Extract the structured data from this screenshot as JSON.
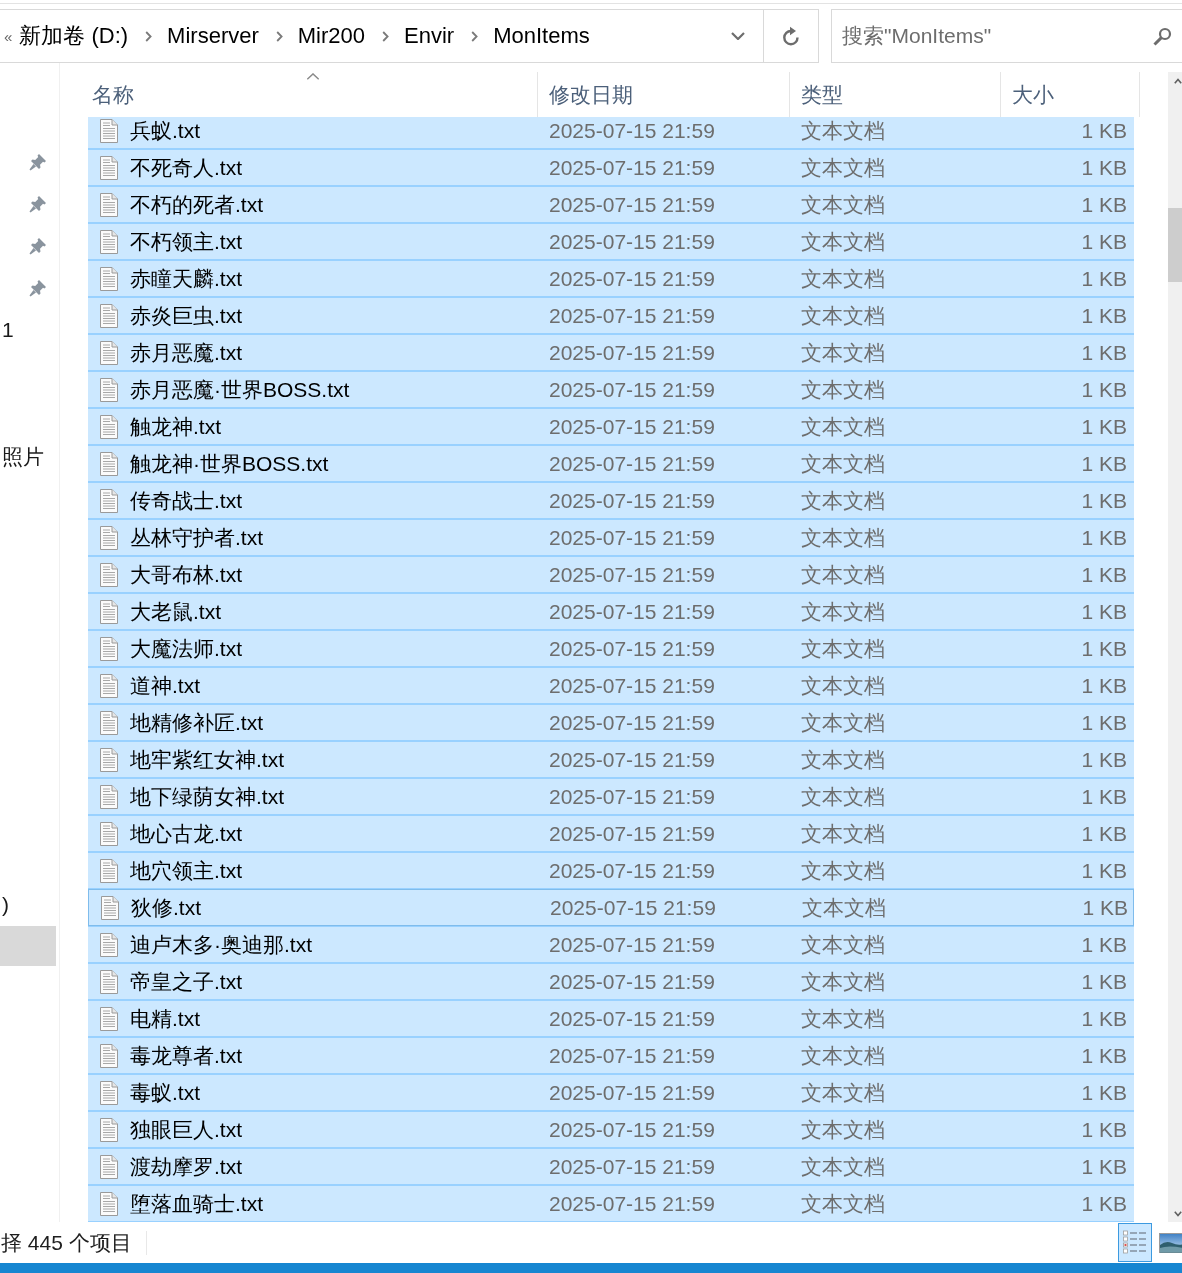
{
  "address_bar": {
    "overflow": "«",
    "crumbs": [
      "新加卷 (D:)",
      "Mirserver",
      "Mir200",
      "Envir",
      "MonItems"
    ]
  },
  "search": {
    "placeholder": "搜索\"MonItems\""
  },
  "nav_pane": {
    "items": [
      {
        "pinned": true,
        "selected": false
      },
      {
        "pinned": true,
        "selected": false
      },
      {
        "pinned": true,
        "selected": false
      },
      {
        "pinned": true,
        "selected": false
      },
      {
        "label": "1",
        "pinned": false,
        "selected": false
      },
      {
        "label": "照片",
        "pinned": false,
        "selected": false
      },
      {
        "label": ")",
        "pinned": false,
        "selected": false
      },
      {
        "pinned": false,
        "selected": true
      }
    ]
  },
  "file_list": {
    "columns": [
      {
        "label": "名称",
        "sorted": true
      },
      {
        "label": "修改日期",
        "sorted": false
      },
      {
        "label": "类型",
        "sorted": false
      },
      {
        "label": "大小",
        "sorted": false
      }
    ],
    "rows": [
      {
        "name": "兵蚁.txt",
        "modified": "2025-07-15 21:59",
        "type": "文本文档",
        "size": "1 KB",
        "selected": true,
        "focused": false
      },
      {
        "name": "不死奇人.txt",
        "modified": "2025-07-15 21:59",
        "type": "文本文档",
        "size": "1 KB",
        "selected": true,
        "focused": false
      },
      {
        "name": "不朽的死者.txt",
        "modified": "2025-07-15 21:59",
        "type": "文本文档",
        "size": "1 KB",
        "selected": true,
        "focused": false
      },
      {
        "name": "不朽领主.txt",
        "modified": "2025-07-15 21:59",
        "type": "文本文档",
        "size": "1 KB",
        "selected": true,
        "focused": false
      },
      {
        "name": "赤瞳天麟.txt",
        "modified": "2025-07-15 21:59",
        "type": "文本文档",
        "size": "1 KB",
        "selected": true,
        "focused": false
      },
      {
        "name": "赤炎巨虫.txt",
        "modified": "2025-07-15 21:59",
        "type": "文本文档",
        "size": "1 KB",
        "selected": true,
        "focused": false
      },
      {
        "name": "赤月恶魔.txt",
        "modified": "2025-07-15 21:59",
        "type": "文本文档",
        "size": "1 KB",
        "selected": true,
        "focused": false
      },
      {
        "name": "赤月恶魔·世界BOSS.txt",
        "modified": "2025-07-15 21:59",
        "type": "文本文档",
        "size": "1 KB",
        "selected": true,
        "focused": false
      },
      {
        "name": "触龙神.txt",
        "modified": "2025-07-15 21:59",
        "type": "文本文档",
        "size": "1 KB",
        "selected": true,
        "focused": false
      },
      {
        "name": "触龙神·世界BOSS.txt",
        "modified": "2025-07-15 21:59",
        "type": "文本文档",
        "size": "1 KB",
        "selected": true,
        "focused": false
      },
      {
        "name": "传奇战士.txt",
        "modified": "2025-07-15 21:59",
        "type": "文本文档",
        "size": "1 KB",
        "selected": true,
        "focused": false
      },
      {
        "name": "丛林守护者.txt",
        "modified": "2025-07-15 21:59",
        "type": "文本文档",
        "size": "1 KB",
        "selected": true,
        "focused": false
      },
      {
        "name": "大哥布林.txt",
        "modified": "2025-07-15 21:59",
        "type": "文本文档",
        "size": "1 KB",
        "selected": true,
        "focused": false
      },
      {
        "name": "大老鼠.txt",
        "modified": "2025-07-15 21:59",
        "type": "文本文档",
        "size": "1 KB",
        "selected": true,
        "focused": false
      },
      {
        "name": "大魔法师.txt",
        "modified": "2025-07-15 21:59",
        "type": "文本文档",
        "size": "1 KB",
        "selected": true,
        "focused": false
      },
      {
        "name": "道神.txt",
        "modified": "2025-07-15 21:59",
        "type": "文本文档",
        "size": "1 KB",
        "selected": true,
        "focused": false
      },
      {
        "name": "地精修补匠.txt",
        "modified": "2025-07-15 21:59",
        "type": "文本文档",
        "size": "1 KB",
        "selected": true,
        "focused": false
      },
      {
        "name": "地牢紫红女神.txt",
        "modified": "2025-07-15 21:59",
        "type": "文本文档",
        "size": "1 KB",
        "selected": true,
        "focused": false
      },
      {
        "name": "地下绿荫女神.txt",
        "modified": "2025-07-15 21:59",
        "type": "文本文档",
        "size": "1 KB",
        "selected": true,
        "focused": false
      },
      {
        "name": "地心古龙.txt",
        "modified": "2025-07-15 21:59",
        "type": "文本文档",
        "size": "1 KB",
        "selected": true,
        "focused": false
      },
      {
        "name": "地穴领主.txt",
        "modified": "2025-07-15 21:59",
        "type": "文本文档",
        "size": "1 KB",
        "selected": true,
        "focused": false
      },
      {
        "name": "狄修.txt",
        "modified": "2025-07-15 21:59",
        "type": "文本文档",
        "size": "1 KB",
        "selected": true,
        "focused": true
      },
      {
        "name": "迪卢木多·奥迪那.txt",
        "modified": "2025-07-15 21:59",
        "type": "文本文档",
        "size": "1 KB",
        "selected": true,
        "focused": false
      },
      {
        "name": "帝皇之子.txt",
        "modified": "2025-07-15 21:59",
        "type": "文本文档",
        "size": "1 KB",
        "selected": true,
        "focused": false
      },
      {
        "name": "电精.txt",
        "modified": "2025-07-15 21:59",
        "type": "文本文档",
        "size": "1 KB",
        "selected": true,
        "focused": false
      },
      {
        "name": "毒龙尊者.txt",
        "modified": "2025-07-15 21:59",
        "type": "文本文档",
        "size": "1 KB",
        "selected": true,
        "focused": false
      },
      {
        "name": "毒蚁.txt",
        "modified": "2025-07-15 21:59",
        "type": "文本文档",
        "size": "1 KB",
        "selected": true,
        "focused": false
      },
      {
        "name": "独眼巨人.txt",
        "modified": "2025-07-15 21:59",
        "type": "文本文档",
        "size": "1 KB",
        "selected": true,
        "focused": false
      },
      {
        "name": "渡劫摩罗.txt",
        "modified": "2025-07-15 21:59",
        "type": "文本文档",
        "size": "1 KB",
        "selected": true,
        "focused": false
      },
      {
        "name": "堕落血骑士.txt",
        "modified": "2025-07-15 21:59",
        "type": "文本文档",
        "size": "1 KB",
        "selected": true,
        "focused": false
      }
    ]
  },
  "status_bar": {
    "text": "择 445 个项目",
    "view_buttons": [
      {
        "kind": "details",
        "selected": true
      },
      {
        "kind": "large_icons",
        "selected": false
      }
    ]
  }
}
